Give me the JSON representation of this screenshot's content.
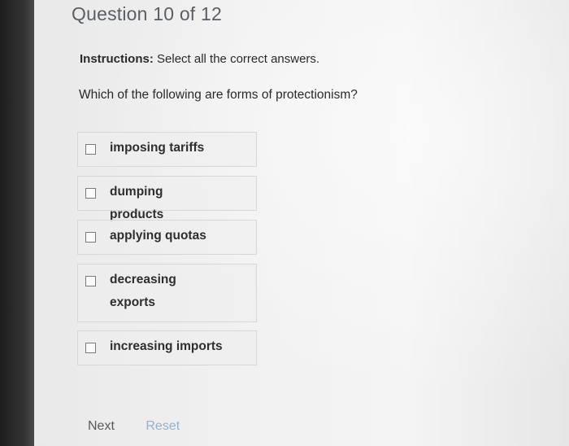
{
  "header": {
    "title": "Question 10 of 12"
  },
  "instructions": {
    "label": "Instructions:",
    "text": " Select all the correct answers."
  },
  "question": {
    "text": "Which of the following are forms of protectionism?"
  },
  "options": [
    {
      "label": "imposing tariffs",
      "checked": false
    },
    {
      "label": "dumping products",
      "checked": false
    },
    {
      "label": "applying quotas",
      "checked": false
    },
    {
      "label": "decreasing exports",
      "checked": false
    },
    {
      "label": "increasing imports",
      "checked": false
    }
  ],
  "footer": {
    "next_label": "Next",
    "reset_label": "Reset"
  },
  "colors": {
    "header_text": "#5a5f66",
    "reset_link": "#8fb3d0",
    "option_border": "#d7d7d7"
  }
}
